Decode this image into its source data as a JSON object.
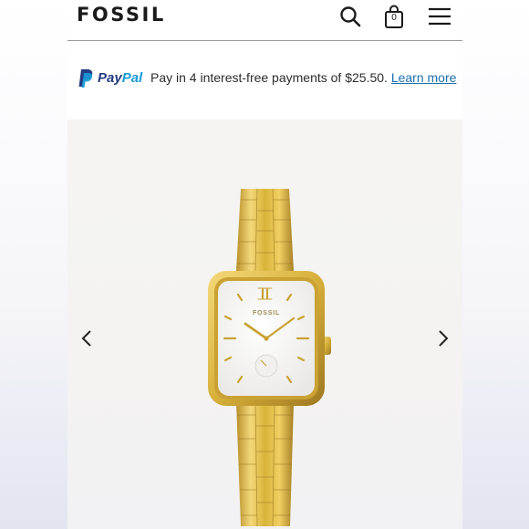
{
  "header": {
    "logo": "FOSSIL",
    "search_icon": "search-icon",
    "bag_icon": "shopping-bag-icon",
    "bag_count": "0",
    "menu_icon": "hamburger-menu-icon"
  },
  "promo": {
    "paypal_logo_pay": "Pay",
    "paypal_logo_pal": "Pal",
    "text": "Pay in 4 interest-free payments of $25.50.",
    "link": "Learn more"
  },
  "gallery": {
    "prev_icon": "chevron-left-icon",
    "next_icon": "chevron-right-icon",
    "product_image": "gold-square-watch",
    "dial_brand": "FOSSIL"
  },
  "colors": {
    "paypal_dark": "#253b80",
    "paypal_light": "#179bd7",
    "link": "#1a6fb0",
    "gold": "#d9b43a"
  }
}
